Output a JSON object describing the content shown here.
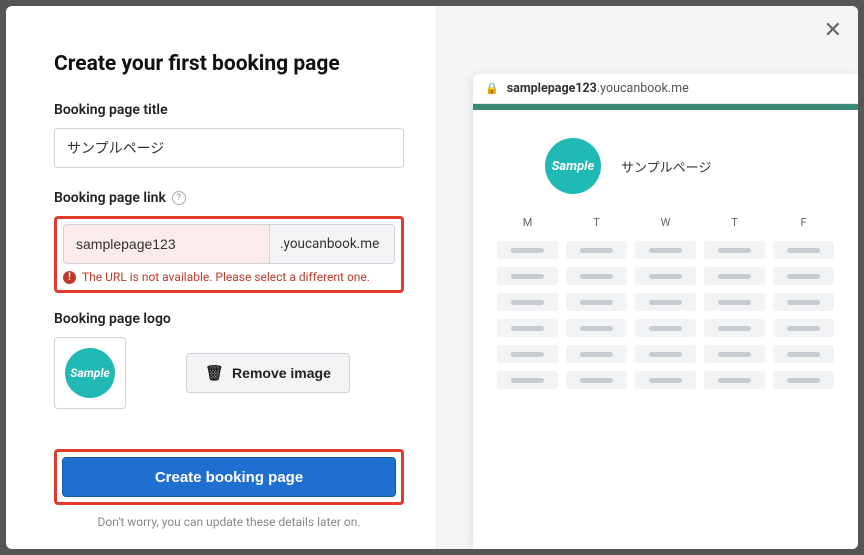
{
  "heading": "Create your first booking page",
  "labels": {
    "title": "Booking page title",
    "link": "Booking page link",
    "logo": "Booking page logo"
  },
  "title_value": "サンプルページ",
  "link": {
    "subdomain": "samplepage123",
    "suffix": ".youcanbook.me",
    "error": "The URL is not available. Please select a different one."
  },
  "logo": {
    "sample_text": "Sample",
    "remove_label": "Remove image"
  },
  "cta_label": "Create booking page",
  "subnote": "Don't worry, you can update these details later on.",
  "preview": {
    "subdomain": "samplepage123",
    "domain": ".youcanbook.me",
    "page_title": "サンプルページ",
    "days": [
      "M",
      "T",
      "W",
      "T",
      "F"
    ]
  }
}
